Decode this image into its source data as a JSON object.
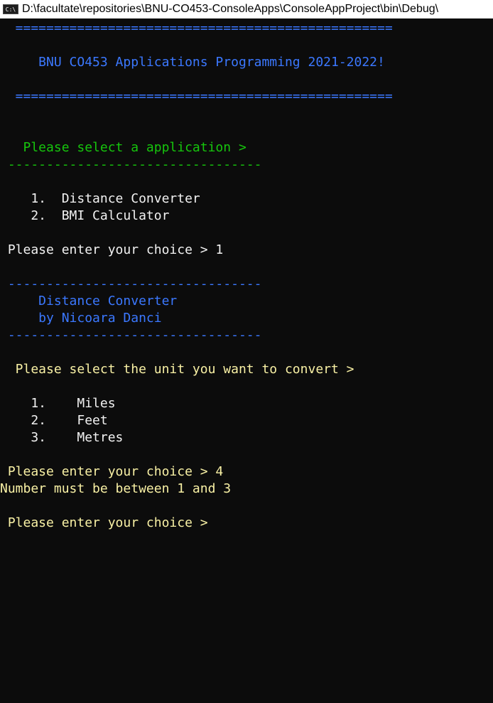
{
  "window": {
    "title": "D:\\facultate\\repositories\\BNU-CO453-ConsoleApps\\ConsoleAppProject\\bin\\Debug\\",
    "icon": "C:\\"
  },
  "console": {
    "header_rule_top": "  =================================================",
    "header_title": "     BNU CO453 Applications Programming 2021-2022!",
    "header_rule_bottom": "  =================================================",
    "app_prompt": "   Please select a application >",
    "app_rule": " ---------------------------------",
    "app_option_1": "    1.  Distance Converter",
    "app_option_2": "    2.  BMI Calculator",
    "choice_prompt_1": " Please enter your choice > 1",
    "dc_rule_top": " ---------------------------------",
    "dc_title": "     Distance Converter",
    "dc_author": "     by Nicoara Danci",
    "dc_rule_bottom": " ---------------------------------",
    "unit_prompt": "  Please select the unit you want to convert >",
    "unit_option_1": "    1.    Miles",
    "unit_option_2": "    2.    Feet",
    "unit_option_3": "    3.    Metres",
    "choice_prompt_2": " Please enter your choice > 4",
    "error_message": "Number must be between 1 and 3",
    "choice_prompt_3": " Please enter your choice >"
  },
  "colors": {
    "background": "#0c0c0c",
    "blue": "#3b78ff",
    "green": "#16c60c",
    "white": "#f2f2f2",
    "yellow": "#f9f1a5"
  }
}
